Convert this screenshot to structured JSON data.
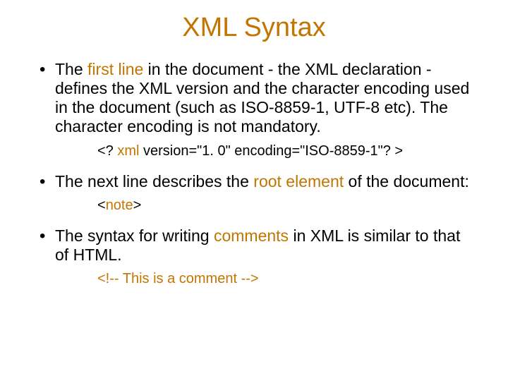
{
  "title": "XML Syntax",
  "bullets": [
    {
      "pre1": "The ",
      "hl1": "first line",
      "post1": " in the document - the XML declaration - defines the XML version and the character encoding used in the document (such as ISO-8859-1, UTF-8 etc). The character encoding is not mandatory.",
      "code_pre": "<? ",
      "code_hl": "xml",
      "code_post": " version=\"1. 0\" encoding=\"ISO-8859-1\"? >"
    },
    {
      "pre1": "The next line describes the ",
      "hl1": "root element",
      "post1": " of the document:",
      "code_pre": "<",
      "code_hl": "note",
      "code_post": ">"
    },
    {
      "pre1": "The syntax for writing ",
      "hl1": "comments",
      "post1": " in XML is similar to that of HTML.",
      "code_pre": "",
      "code_hl": "<!-- This is a comment -->",
      "code_post": ""
    }
  ]
}
